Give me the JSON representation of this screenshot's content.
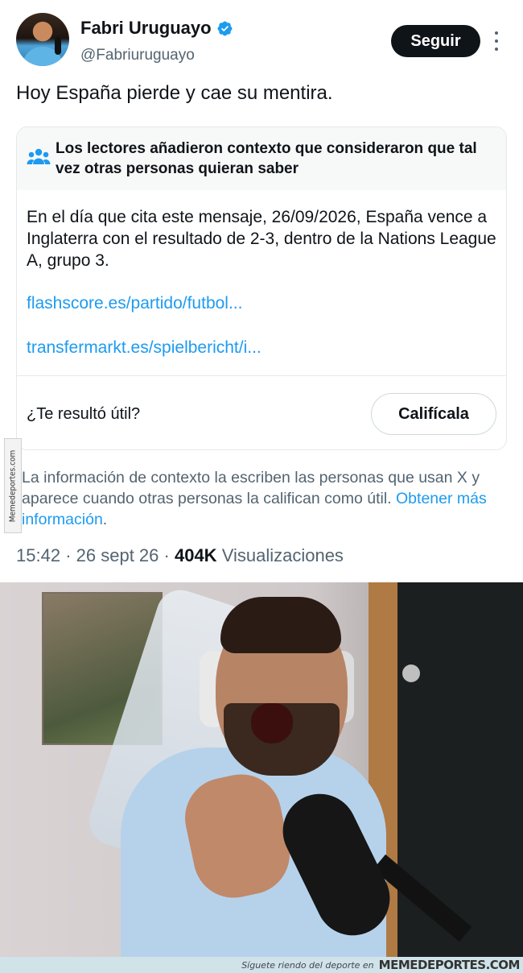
{
  "author": {
    "display_name": "Fabri Uruguayo",
    "handle": "@Fabriuruguayo",
    "verified": true,
    "avatar_icon": "avatar-photo"
  },
  "actions": {
    "follow_label": "Seguir",
    "more_icon": "more-icon"
  },
  "tweet": {
    "text": "Hoy España pierde y cae su mentira."
  },
  "community_note": {
    "icon": "people-icon",
    "title": "Los lectores añadieron contexto que consideraron que tal vez otras personas quieran saber",
    "body": "En el día que cita este mensaje, 26/09/2026, España vence a Inglaterra con el resultado de 2-3, dentro de la Nations League A, grupo 3.",
    "links": [
      "flashscore.es/partido/futbol...",
      "transfermarkt.es/spielbericht/i..."
    ],
    "useful_question": "¿Te resultó útil?",
    "rate_label": "Califícala"
  },
  "disclaimer": {
    "text": "La información de contexto la escriben las personas que usan X y aparece cuando otras personas la califican como útil.",
    "link": "Obtener más información",
    "suffix": "."
  },
  "meta": {
    "time": "15:42",
    "date": "26 sept 26",
    "views_count": "404K",
    "views_label": "Visualizaciones"
  },
  "watermark": {
    "side": "Memedeportes.com",
    "tagline": "Síguete riendo del deporte en",
    "brand": "MEMEDEPORTES.COM"
  },
  "colors": {
    "link": "#1d9bf0",
    "verified": "#1d9bf0",
    "secondary_text": "#536471",
    "button_dark": "#0f1419"
  }
}
